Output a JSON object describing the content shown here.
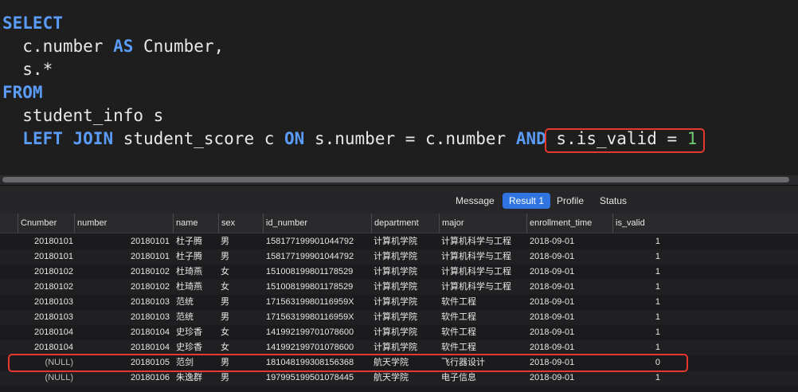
{
  "sql": {
    "lines": [
      [
        {
          "t": "SELECT",
          "c": "kw"
        }
      ],
      [
        {
          "t": "  c.number ",
          "c": ""
        },
        {
          "t": "AS",
          "c": "kw"
        },
        {
          "t": " Cnumber,",
          "c": ""
        }
      ],
      [
        {
          "t": "  s.*",
          "c": ""
        }
      ],
      [
        {
          "t": "FROM",
          "c": "kw"
        }
      ],
      [
        {
          "t": "  student_info s",
          "c": ""
        }
      ],
      [
        {
          "t": "  ",
          "c": ""
        },
        {
          "t": "LEFT JOIN",
          "c": "kw"
        },
        {
          "t": " student_score c ",
          "c": ""
        },
        {
          "t": "ON",
          "c": "kw"
        },
        {
          "t": " s.number = c.number ",
          "c": ""
        },
        {
          "t": "AND",
          "c": "kw"
        },
        {
          "t": " s.is_valid = ",
          "c": ""
        },
        {
          "t": "1",
          "c": "num"
        }
      ]
    ]
  },
  "tabs": {
    "message": "Message",
    "result": "Result 1",
    "profile": "Profile",
    "status": "Status"
  },
  "columns": [
    "Cnumber",
    "number",
    "name",
    "sex",
    "id_number",
    "department",
    "major",
    "enrollment_time",
    "is_valid"
  ],
  "rows": [
    [
      "20180101",
      "20180101",
      "杜子腾",
      "男",
      "158177199901044792",
      "计算机学院",
      "计算机科学与工程",
      "2018-09-01",
      "1"
    ],
    [
      "20180101",
      "20180101",
      "杜子腾",
      "男",
      "158177199901044792",
      "计算机学院",
      "计算机科学与工程",
      "2018-09-01",
      "1"
    ],
    [
      "20180102",
      "20180102",
      "杜琦燕",
      "女",
      "151008199801178529",
      "计算机学院",
      "计算机科学与工程",
      "2018-09-01",
      "1"
    ],
    [
      "20180102",
      "20180102",
      "杜琦燕",
      "女",
      "151008199801178529",
      "计算机学院",
      "计算机科学与工程",
      "2018-09-01",
      "1"
    ],
    [
      "20180103",
      "20180103",
      "范统",
      "男",
      "17156319980116959X",
      "计算机学院",
      "软件工程",
      "2018-09-01",
      "1"
    ],
    [
      "20180103",
      "20180103",
      "范统",
      "男",
      "17156319980116959X",
      "计算机学院",
      "软件工程",
      "2018-09-01",
      "1"
    ],
    [
      "20180104",
      "20180104",
      "史珍香",
      "女",
      "141992199701078600",
      "计算机学院",
      "软件工程",
      "2018-09-01",
      "1"
    ],
    [
      "20180104",
      "20180104",
      "史珍香",
      "女",
      "141992199701078600",
      "计算机学院",
      "软件工程",
      "2018-09-01",
      "1"
    ],
    [
      "(NULL)",
      "20180105",
      "范剑",
      "男",
      "181048199308156368",
      "航天学院",
      "飞行器设计",
      "2018-09-01",
      "0"
    ],
    [
      "(NULL)",
      "20180106",
      "朱逸群",
      "男",
      "197995199501078445",
      "航天学院",
      "电子信息",
      "2018-09-01",
      "1"
    ]
  ]
}
